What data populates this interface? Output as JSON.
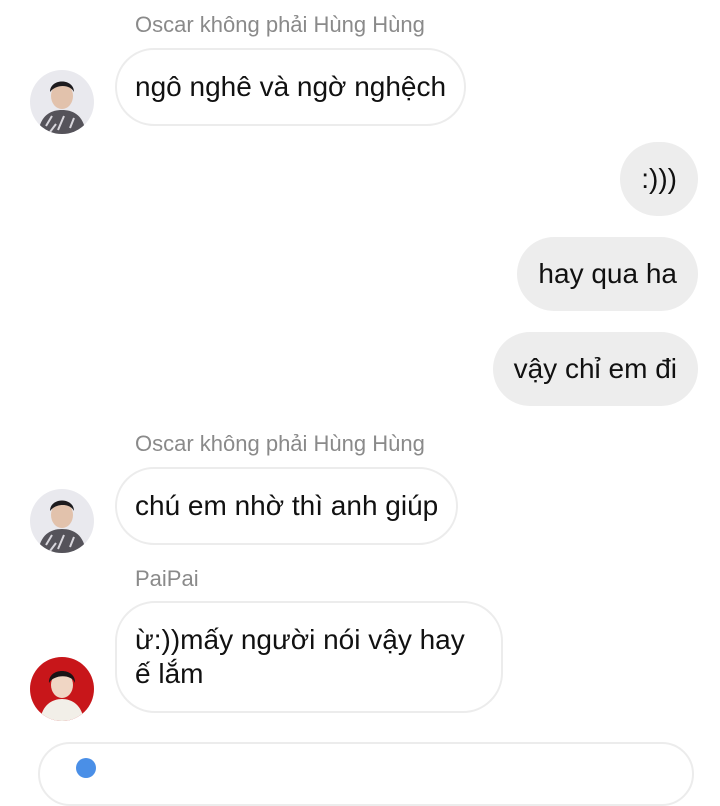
{
  "messages": [
    {
      "sender": "Oscar không phải Hùng Hùng",
      "text": "ngô nghê và ngờ nghệch",
      "direction": "incoming"
    },
    {
      "text": ":)))",
      "direction": "outgoing"
    },
    {
      "text": "hay qua ha",
      "direction": "outgoing"
    },
    {
      "text": "vậy chỉ em đi",
      "direction": "outgoing"
    },
    {
      "sender": "Oscar không phải Hùng Hùng",
      "text": "chú em nhờ thì anh giúp",
      "direction": "incoming"
    },
    {
      "sender": "PaiPai",
      "text": "ừ:))mấy người nói vậy hay ế lắm",
      "direction": "incoming"
    }
  ],
  "colors": {
    "incoming_bubble": "#ffffff",
    "incoming_border": "#ececec",
    "outgoing_bubble": "#ededed",
    "sender_name": "#8a8a8a",
    "text": "#111111"
  }
}
